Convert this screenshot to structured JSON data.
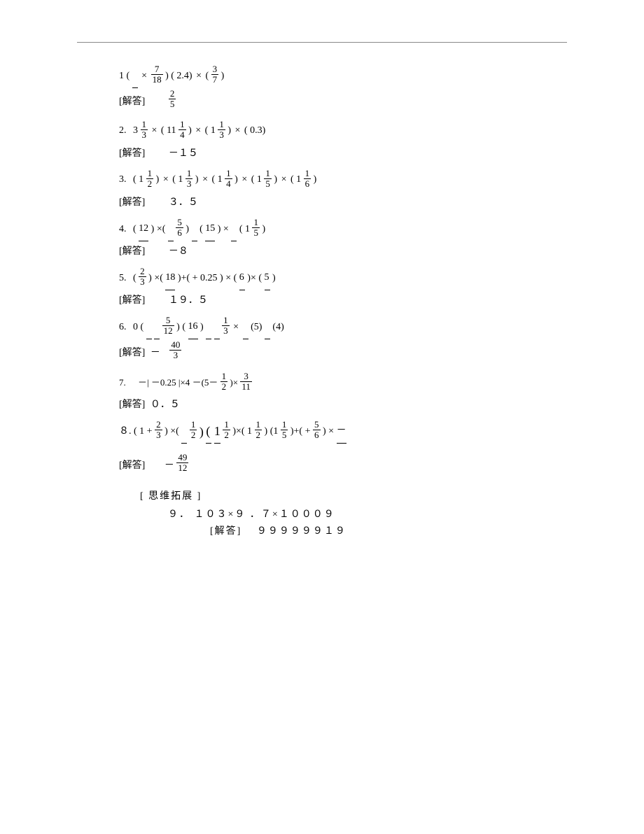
{
  "problems": [
    {
      "num": "1",
      "expr_parts": {
        "open1": "(",
        "f1_num": "7",
        "f1_den": "18",
        "times1": "×",
        "close1_open2": ") ( 2.4)",
        "times2": "×",
        "open3": "(",
        "f2_num": "3",
        "f2_den": "7",
        "close3": ")"
      },
      "answer_label": "[解答]",
      "answer_frac": {
        "num": "2",
        "den": "5"
      },
      "answer_prefix": ""
    },
    {
      "num": "2.",
      "expr_text": "3",
      "mix1": {
        "i": "1",
        "d": "3"
      },
      "times1": "×",
      "open1": "(",
      "mix2_pre": "11",
      "mix2": {
        "i": "1",
        "d": "4"
      },
      "close1": ")",
      "times2": "×",
      "open2": "(",
      "mix3_pre": "1",
      "mix3": {
        "i": "1",
        "d": "3"
      },
      "close2": ")",
      "times3": "×",
      "open3": "(",
      "tail": "0.3)",
      "answer_label": "[解答]",
      "answer_text": "－１５"
    },
    {
      "num": "3.",
      "pattern_pre": "( 1",
      "items": [
        {
          "i": "1",
          "d": "2"
        },
        {
          "i": "1",
          "d": "3"
        },
        {
          "i": "1",
          "d": "4"
        },
        {
          "i": "1",
          "d": "5"
        },
        {
          "i": "1",
          "d": "6"
        }
      ],
      "close": ")",
      "times": "×",
      "answer_label": "[解答]",
      "answer_text": "３．５"
    },
    {
      "num": "4.",
      "p1": "( ",
      "n1": "12",
      "p2": ") ×(",
      "f1": {
        "n": "5",
        "d": "6"
      },
      "p3": ")",
      "p4": "( ",
      "n2": "15",
      "p5": ") ×",
      "p6": "( 1",
      "f2": {
        "n": "1",
        "d": "5"
      },
      "p7": ")",
      "answer_label": "[解答]",
      "answer_text": "－８"
    },
    {
      "num": "5.",
      "p1": "(",
      "f1": {
        "n": "2",
        "d": "3"
      },
      "p2": ") ×(",
      "n1": "18",
      "p3": ")+(",
      "plus": "+",
      "n2": "0.25",
      "p4": ") × (",
      "n3": "6",
      "p5": ")× (",
      "n4": "5",
      "p6": ")",
      "answer_label": "[解答]",
      "answer_text": "１９．５"
    },
    {
      "num": "6.",
      "p1": "0 (",
      "f1": {
        "n": "5",
        "d": "12"
      },
      "p2": ") (",
      "n1": "16",
      "p3": ")",
      "f2": {
        "n": "1",
        "d": "3"
      },
      "p4": "×",
      "n2": "(5)",
      "n3": "(4)",
      "answer_label": "[解答]",
      "answer_prefix": "－",
      "answer_frac": {
        "num": "40",
        "den": "3"
      }
    },
    {
      "num": "7.",
      "p1": "－|",
      "n1": "－0.25",
      "p2": "|×4",
      "p3": "－(5－",
      "f1": {
        "n": "1",
        "d": "2"
      },
      "p4": ")×",
      "f2": {
        "n": "3",
        "d": "11"
      },
      "answer_label": "[解答]",
      "answer_text": "０．５"
    },
    {
      "num": "８.",
      "p1": "( 1",
      "plus1": "+",
      "f1": {
        "n": "2",
        "d": "3"
      },
      "p2": ") ×(",
      "f2": {
        "n": "1",
        "d": "2"
      },
      "p3": ")",
      "p4": "(",
      "underline_open": "1",
      "f3": {
        "n": "1",
        "d": "2"
      },
      "p5": ")×(",
      "p6": "1",
      "f4": {
        "n": "1",
        "d": "2"
      },
      "p7": ") (1",
      "f5": {
        "n": "1",
        "d": "5"
      },
      "p8": ")+(",
      "plus2": "+",
      "f6": {
        "n": "5",
        "d": "6"
      },
      "p9": ") ×",
      "tail": "－",
      "answer_label": "[解答]",
      "answer_prefix": "－",
      "answer_frac": {
        "num": "49",
        "den": "12"
      }
    }
  ],
  "extension": {
    "heading": "[ 思维拓展 ]",
    "problem_num": "９．",
    "problem_text": "１０３×９ ．７×１０００９",
    "answer_label": "[解答]",
    "answer_text": "９９９９９９１９"
  }
}
